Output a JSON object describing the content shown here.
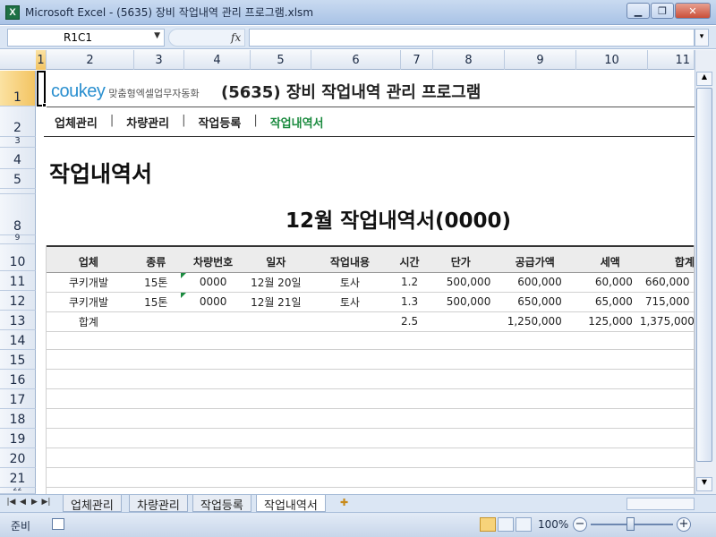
{
  "window": {
    "title": "Microsoft Excel - (5635) 장비 작업내역 관리 프로그램.xlsm",
    "app_icon": "X"
  },
  "formula_bar": {
    "name_box": "R1C1",
    "fx": "fx",
    "formula": ""
  },
  "columns": [
    "1",
    "2",
    "3",
    "4",
    "5",
    "6",
    "7",
    "8",
    "9",
    "10",
    "11"
  ],
  "rows": [
    "1",
    "2",
    "3",
    "4",
    "5",
    "",
    "8",
    "9",
    "10",
    "11",
    "12",
    "13",
    "14",
    "15",
    "16",
    "17",
    "18",
    "19",
    "20",
    "21",
    "22"
  ],
  "sheet": {
    "logo_main": "cou",
    "logo_key": "key",
    "logo_sub": "맞춤형엑셀업무자동화",
    "program_title": "(5635) 장비 작업내역 관리 프로그램",
    "nav": [
      {
        "label": "업체관리",
        "active": false
      },
      {
        "label": "차량관리",
        "active": false
      },
      {
        "label": "작업등록",
        "active": false
      },
      {
        "label": "작업내역서",
        "active": true
      }
    ],
    "nav_separator": "|",
    "page_heading": "작업내역서",
    "doc_title": "12월 작업내역서(0000)"
  },
  "table": {
    "headers": [
      "업체",
      "종류",
      "차량번호",
      "일자",
      "작업내용",
      "시간",
      "단가",
      "공급가액",
      "세액",
      "합계"
    ],
    "rows": [
      [
        "쿠키개발",
        "15톤",
        "0000",
        "12월 20일",
        "토사",
        "1.2",
        "500,000",
        "600,000",
        "60,000",
        "660,000"
      ],
      [
        "쿠키개발",
        "15톤",
        "0000",
        "12월 21일",
        "토사",
        "1.3",
        "500,000",
        "650,000",
        "65,000",
        "715,000"
      ]
    ],
    "total": [
      "합계",
      "",
      "",
      "",
      "",
      "2.5",
      "",
      "1,250,000",
      "125,000",
      "1,375,000"
    ]
  },
  "tabs": [
    {
      "label": "업체관리",
      "active": false
    },
    {
      "label": "차량관리",
      "active": false
    },
    {
      "label": "작업등록",
      "active": false
    },
    {
      "label": "작업내역서",
      "active": true
    }
  ],
  "status": {
    "ready": "준비",
    "zoom": "100%",
    "zoom_minus": "−",
    "zoom_plus": "+"
  }
}
